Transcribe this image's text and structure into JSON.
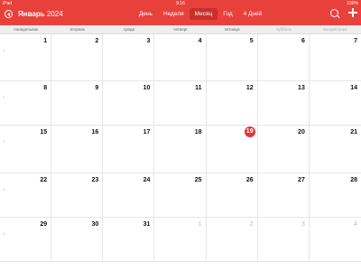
{
  "status": {
    "device": "iPad",
    "time": "9:16",
    "battery": "100%"
  },
  "header": {
    "month_name": "Январь",
    "year": "2024",
    "tabs": [
      "День",
      "Неделя",
      "Месяц",
      "Год",
      "4 Дней"
    ],
    "active_tab": "Месяц"
  },
  "weekdays": [
    "понедельник",
    "вторник",
    "среда",
    "четверг",
    "пятница",
    "суббота",
    "воскресенье"
  ],
  "weeks": [
    {
      "num": "1",
      "days": [
        "1",
        "2",
        "3",
        "4",
        "5",
        "6",
        "7"
      ]
    },
    {
      "num": "2",
      "days": [
        "8",
        "9",
        "10",
        "11",
        "12",
        "13",
        "14"
      ]
    },
    {
      "num": "3",
      "days": [
        "15",
        "16",
        "17",
        "18",
        "19",
        "20",
        "21"
      ]
    },
    {
      "num": "4",
      "days": [
        "22",
        "23",
        "24",
        "25",
        "26",
        "27",
        "28"
      ]
    },
    {
      "num": "5",
      "days": [
        "29",
        "30",
        "31",
        "1",
        "2",
        "3",
        "4"
      ]
    }
  ],
  "today": "19",
  "colors": {
    "accent": "#e8413b"
  }
}
